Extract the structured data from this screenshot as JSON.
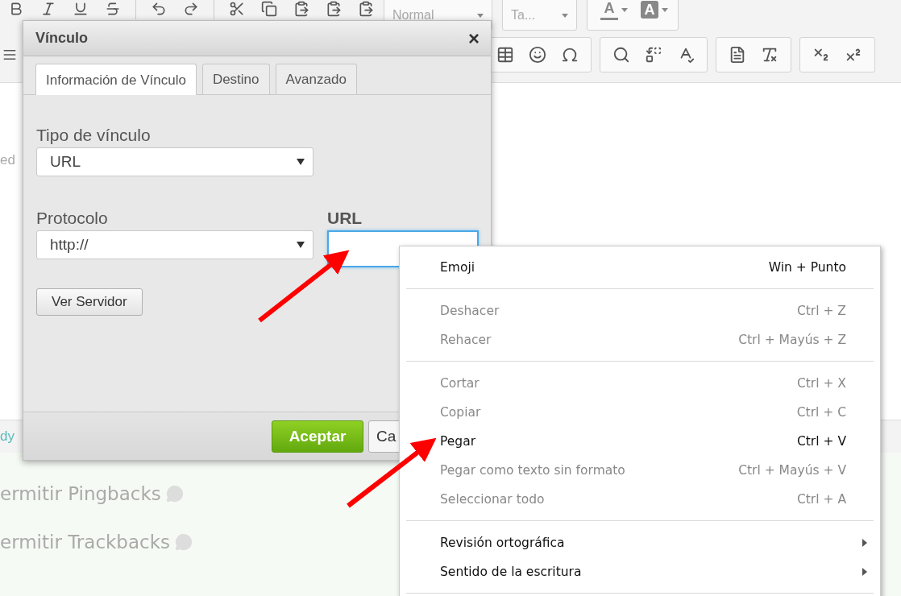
{
  "editor": {
    "toolbar_row_1": [
      {
        "kind": "bold"
      },
      {
        "kind": "italic"
      },
      {
        "kind": "underline"
      },
      {
        "kind": "strike"
      },
      {
        "kind": "sep"
      },
      {
        "kind": "undo"
      },
      {
        "kind": "redo"
      },
      {
        "kind": "sep"
      },
      {
        "kind": "cut"
      },
      {
        "kind": "copy"
      },
      {
        "kind": "paste"
      },
      {
        "kind": "paste"
      },
      {
        "kind": "paste"
      }
    ],
    "combos": [
      {
        "label": "Normal"
      },
      {
        "label": "Ta..."
      }
    ],
    "color_buttons": [
      {
        "kind": "text-color",
        "glyph": "A"
      },
      {
        "kind": "background-color",
        "glyph": "A"
      }
    ],
    "toolbar_row_2": [
      {
        "kind": "table"
      },
      {
        "kind": "smiley"
      },
      {
        "kind": "omega"
      },
      {
        "kind": "group"
      },
      {
        "kind": "search"
      },
      {
        "kind": "replace"
      },
      {
        "kind": "spellcheck"
      },
      {
        "kind": "group"
      },
      {
        "kind": "block"
      },
      {
        "kind": "clear-format"
      },
      {
        "kind": "group"
      },
      {
        "kind": "subscript"
      },
      {
        "kind": "superscript"
      }
    ],
    "content_fragment": "ed",
    "path_fragment": "dy"
  },
  "options": [
    {
      "label": "ermitir Pingbacks"
    },
    {
      "label": "ermitir Trackbacks"
    }
  ],
  "dialog": {
    "title": "Vínculo",
    "close": "×",
    "tabs": [
      {
        "label": "Información de Vínculo",
        "selected": true
      },
      {
        "label": "Destino",
        "selected": false
      },
      {
        "label": "Avanzado",
        "selected": false
      }
    ],
    "link_type": {
      "label": "Tipo de vínculo",
      "value": "URL"
    },
    "protocol": {
      "label": "Protocolo",
      "value": "http://"
    },
    "url": {
      "label": "URL",
      "focused": true
    },
    "browse_button": "Ver Servidor",
    "ok_button": "Aceptar",
    "cancel_button": "Ca"
  },
  "context_menu": {
    "items": [
      {
        "kind": "item",
        "label": "Emoji",
        "shortcut": "Win + Punto",
        "disabled": false,
        "submenu": false
      },
      {
        "kind": "separator"
      },
      {
        "kind": "item",
        "label": "Deshacer",
        "shortcut": "Ctrl + Z",
        "disabled": true,
        "submenu": false
      },
      {
        "kind": "item",
        "label": "Rehacer",
        "shortcut": "Ctrl + Mayús + Z",
        "disabled": true,
        "submenu": false
      },
      {
        "kind": "separator"
      },
      {
        "kind": "item",
        "label": "Cortar",
        "shortcut": "Ctrl + X",
        "disabled": true,
        "submenu": false
      },
      {
        "kind": "item",
        "label": "Copiar",
        "shortcut": "Ctrl + C",
        "disabled": true,
        "submenu": false
      },
      {
        "kind": "item",
        "label": "Pegar",
        "shortcut": "Ctrl + V",
        "disabled": false,
        "submenu": false
      },
      {
        "kind": "item",
        "label": "Pegar como texto sin formato",
        "shortcut": "Ctrl + Mayús + V",
        "disabled": true,
        "submenu": false
      },
      {
        "kind": "item",
        "label": "Seleccionar todo",
        "shortcut": "Ctrl + A",
        "disabled": true,
        "submenu": false
      },
      {
        "kind": "separator"
      },
      {
        "kind": "item",
        "label": "Revisión ortográfica",
        "disabled": false,
        "submenu": true
      },
      {
        "kind": "item",
        "label": "Sentido de la escritura",
        "disabled": false,
        "submenu": true
      },
      {
        "kind": "separator"
      }
    ]
  }
}
